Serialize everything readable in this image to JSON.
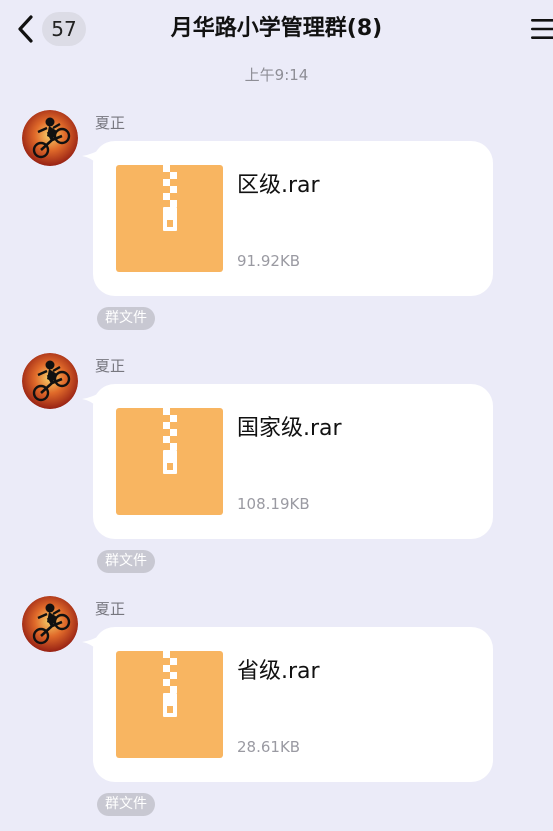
{
  "header": {
    "back_count": "57",
    "title": "月华路小学管理群(8)"
  },
  "timestamp": "上午9:14",
  "messages": [
    {
      "sender": "夏正",
      "file_name": "区级.rar",
      "file_size": "91.92KB",
      "tag": "群文件"
    },
    {
      "sender": "夏正",
      "file_name": "国家级.rar",
      "file_size": "108.19KB",
      "tag": "群文件"
    },
    {
      "sender": "夏正",
      "file_name": "省级.rar",
      "file_size": "28.61KB",
      "tag": "群文件"
    }
  ],
  "icons": {
    "back": "chevron-left-icon",
    "menu": "hamburger-menu-icon",
    "file": "archive-zip-icon"
  },
  "colors": {
    "background": "#ebebf8",
    "bubble": "#ffffff",
    "file_icon": "#f8b561",
    "tag_bg": "#c8c8d2"
  }
}
